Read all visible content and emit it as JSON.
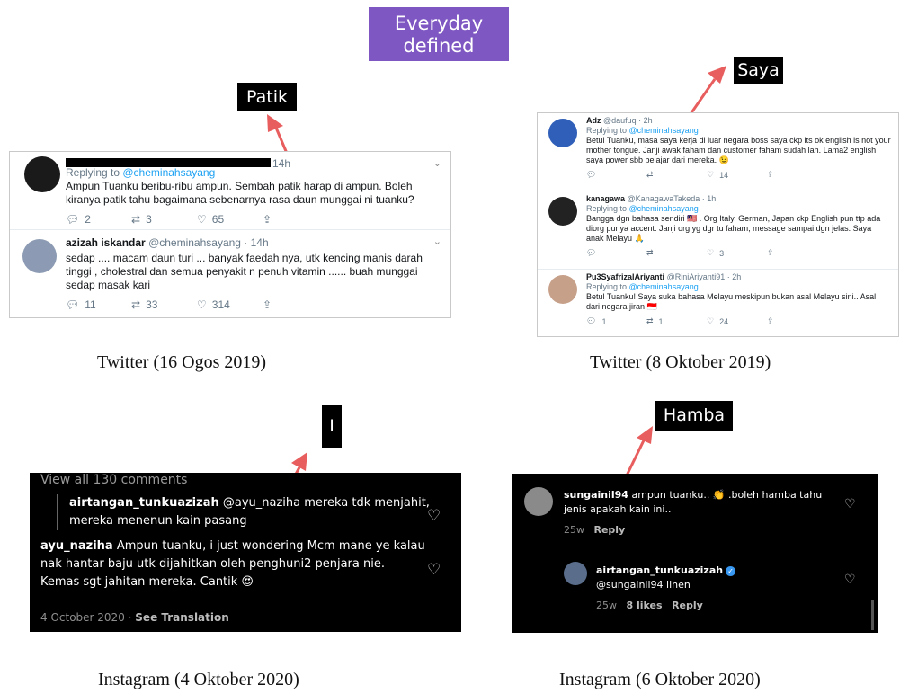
{
  "banner": {
    "line1": "Everyday",
    "line2": "defined"
  },
  "tags": {
    "patik": "Patik",
    "saya": "Saya",
    "i": "I",
    "hamba": "Hamba"
  },
  "captions": {
    "top_left": "Twitter (16 Ogos 2019)",
    "top_right": "Twitter (8 Oktober 2019)",
    "bottom_left": "Instagram (4 Oktober 2020)",
    "bottom_right": "Instagram (6 Oktober 2020)"
  },
  "colors": {
    "banner": "#7e57c2",
    "arrow": "#e85d5d",
    "link": "#1da1f2"
  },
  "twitter_left": {
    "tweets": [
      {
        "time": "14h",
        "reply_prefix": "Replying to ",
        "reply_handle": "@cheminahsayang",
        "body": "Ampun Tuanku beribu-ribu ampun. Sembah patik harap di ampun. Boleh kiranya patik tahu bagaimana sebenarnya rasa daun munggai ni tuanku?",
        "replies": "2",
        "retweets": "3",
        "likes": "65"
      },
      {
        "name": "azizah iskandar",
        "handle": "@cheminahsayang · 14h",
        "body": "sedap .... macam daun turi ... banyak faedah nya, utk kencing manis  darah tinggi , cholestral dan semua penyakit n penuh vitamin ...... buah munggai sedap masak kari",
        "replies": "11",
        "retweets": "33",
        "likes": "314"
      }
    ]
  },
  "twitter_right": {
    "tweets": [
      {
        "name": "Adz",
        "handle": "@daufuq · 2h",
        "reply_prefix": "Replying to ",
        "reply_handle": "@cheminahsayang",
        "body": "Betul Tuanku, masa saya kerja di luar negara boss saya ckp its ok english is not your mother tongue. Janji awak faham dan customer faham sudah lah. Lama2 english saya power sbb belajar dari mereka. 😉",
        "replies": "",
        "retweets": "",
        "likes": "14"
      },
      {
        "name": "kanagawa",
        "handle": "@KanagawaTakeda · 1h",
        "reply_prefix": "Replying to ",
        "reply_handle": "@cheminahsayang",
        "body": "Bangga dgn bahasa sendiri 🇲🇾 . Org Italy, German, Japan ckp English pun ttp ada diorg punya accent. Janji org yg dgr tu faham, message sampai dgn jelas. Saya anak Melayu 🙏",
        "replies": "",
        "retweets": "",
        "likes": "3"
      },
      {
        "name": "Pu3SyafrizalAriyanti",
        "handle": "@RiniAriyanti91 · 2h",
        "reply_prefix": "Replying to ",
        "reply_handle": "@cheminahsayang",
        "body": "Betul Tuanku! Saya suka bahasa Melayu meskipun bukan asal Melayu sini.. Asal dari negara jiran 🇮🇩",
        "replies": "1",
        "retweets": "1",
        "likes": "24"
      }
    ]
  },
  "instagram_left": {
    "view_all": "View all 130 comments",
    "quote_user": "airtangan_tunkuazizah",
    "quote_text": " @ayu_naziha mereka tdk menjahit, mereka menenun kain pasang",
    "main_user": "ayu_naziha",
    "main_text": " Ampun tuanku, i just wondering Mcm mane ye kalau nak hantar baju utk dijahitkan oleh penghuni2 penjara nie. Kemas sgt jahitan mereka. Cantik 😍",
    "date": "4 October 2020",
    "separator": " · ",
    "see_translation": "See Translation"
  },
  "instagram_right": {
    "c1_user": "sungainil94",
    "c1_text": " ampun tuanku.. 👏 .boleh hamba tahu jenis apakah kain ini..",
    "c1_age": "25w",
    "c1_reply": "Reply",
    "c2_user": "airtangan_tunkuazizah",
    "c2_text": "@sungainil94 linen",
    "c2_age": "25w",
    "c2_likes": "8 likes",
    "c2_reply": "Reply"
  }
}
